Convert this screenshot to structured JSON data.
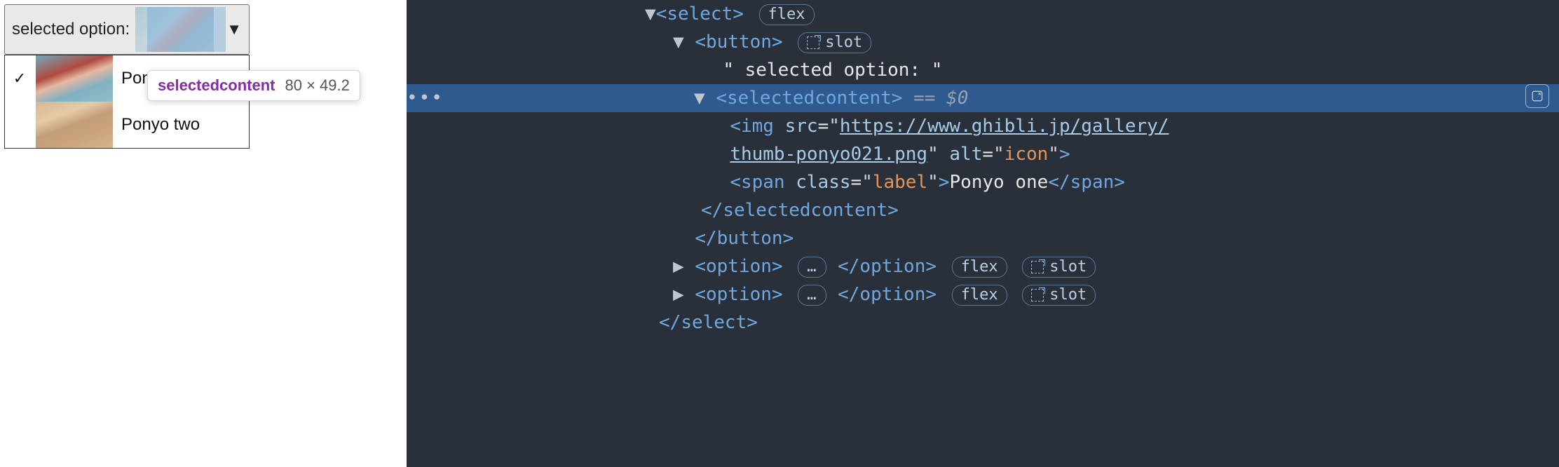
{
  "select": {
    "label_prefix": "selected option:",
    "caret_glyph": "▼",
    "options": [
      {
        "label": "Ponyo one",
        "checked": true,
        "check_glyph": "✓"
      },
      {
        "label": "Ponyo two",
        "checked": false,
        "check_glyph": ""
      }
    ]
  },
  "tooltip": {
    "tag": "selectedcontent",
    "dims": "80 × 49.2"
  },
  "devtools": {
    "row_actions_glyph": "•••",
    "tags": {
      "select": "select",
      "button": "button",
      "selectedcontent": "selectedcontent",
      "img": "img",
      "span": "span",
      "option": "option"
    },
    "badges": {
      "flex": "flex",
      "slot": "slot",
      "ellipsis": "…"
    },
    "text_node": "\" selected option: \"",
    "selected_marker": "== $0",
    "img_src_part1": "https://www.ghibli.jp/gallery/",
    "img_src_part2": "thumb-ponyo021.png",
    "img_alt": "icon",
    "span_class": "label",
    "span_text": "Ponyo one",
    "attr_src": "src",
    "attr_alt": "alt",
    "attr_class": "class"
  }
}
